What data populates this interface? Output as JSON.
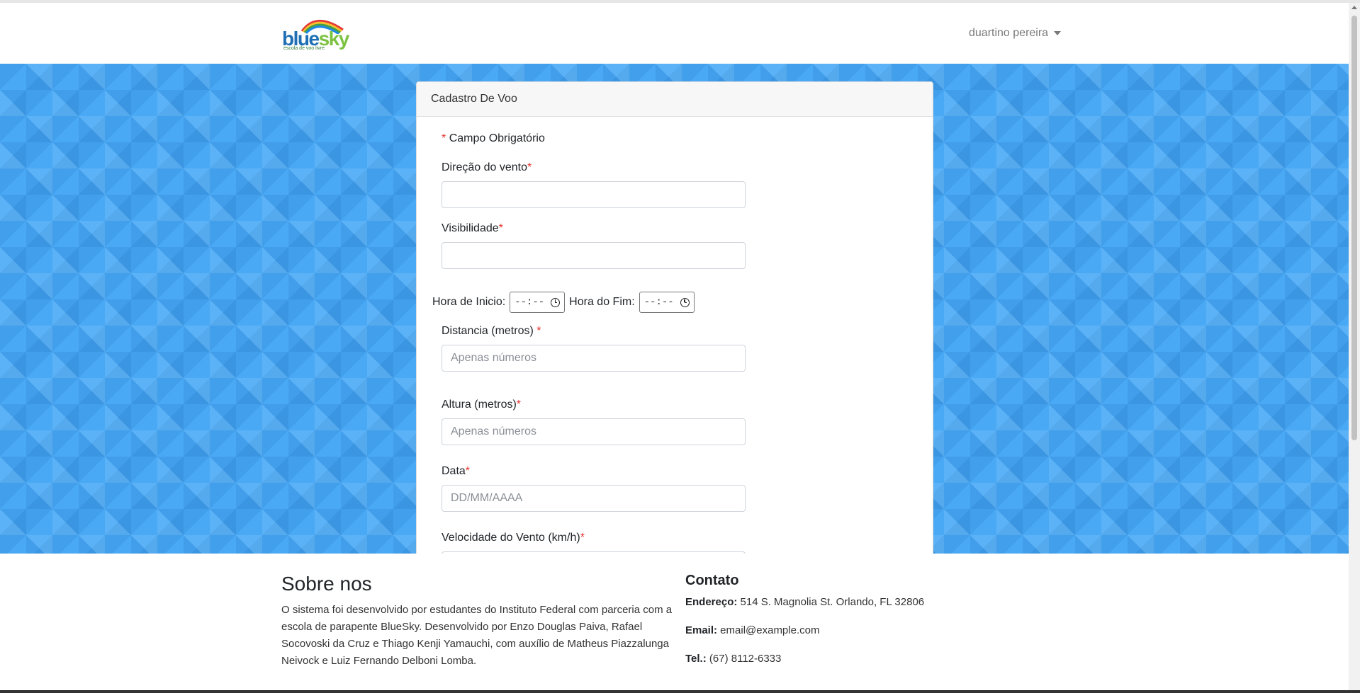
{
  "brand": {
    "name_part1": "blue",
    "name_part2": "sky",
    "tagline": "escola de voo livre"
  },
  "user": {
    "name": "duartino pereira"
  },
  "form": {
    "title": "Cadastro De Voo",
    "required_note": "Campo Obrigatório",
    "wind_direction": {
      "label": "Direção do vento",
      "value": ""
    },
    "visibility": {
      "label": "Visibilidade",
      "value": ""
    },
    "start_time": {
      "label": "Hora de Inicio:",
      "value": "--:--"
    },
    "end_time": {
      "label": "Hora do Fim:",
      "value": "--:--"
    },
    "distance": {
      "label": "Distancia (metros) ",
      "placeholder": "Apenas números"
    },
    "height": {
      "label": "Altura (metros)",
      "placeholder": "Apenas números"
    },
    "date": {
      "label": "Data",
      "placeholder": "DD/MM/AAAA"
    },
    "wind_speed": {
      "label": "Velocidade do Vento (km/h)"
    },
    "required_marker": "*"
  },
  "footer": {
    "about_title": "Sobre nos",
    "about_text": "O sistema foi desenvolvido por estudantes do Instituto Federal com parceria com a escola de parapente BlueSky. Desenvolvido por Enzo Douglas Paiva, Rafael Socovoski da Cruz e Thiago Kenji Yamauchi, com auxílio de Matheus Piazzalunga Neivock e Luiz Fernando Delboni Lomba.",
    "contact_title": "Contato",
    "address_label": "Endereço:",
    "address_value": " 514 S. Magnolia St. Orlando, FL 32806",
    "email_label": "Email:",
    "email_value": " email@example.com",
    "phone_label": "Tel.:",
    "phone_value": " (67) 8112-6333"
  },
  "colors": {
    "hero_blue": "#4aa9f5",
    "required_red": "#e3342f",
    "brand_blue": "#1f6fb5",
    "brand_green": "#7cc242"
  }
}
